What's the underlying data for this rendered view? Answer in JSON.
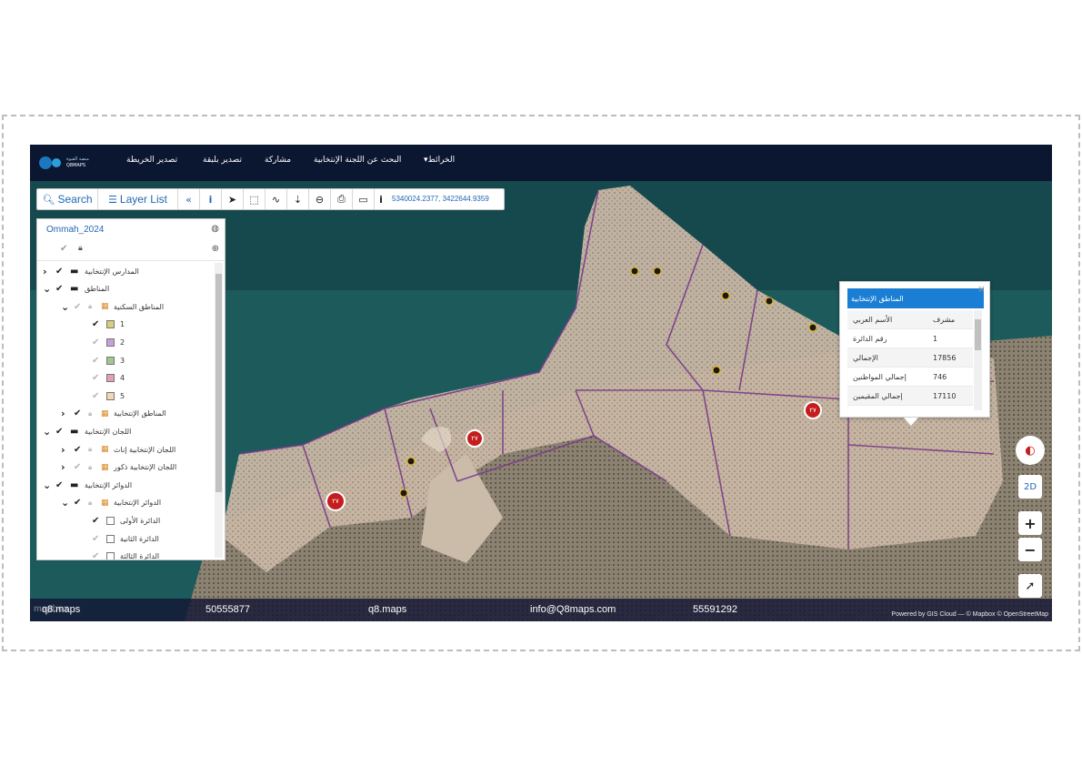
{
  "nav": {
    "logo_text_1": "منصة القبوة",
    "logo_text_2": "Q8MAPS",
    "items": [
      {
        "label": "تصدير الخريطة"
      },
      {
        "label": "تصدير بلبقة"
      },
      {
        "label": "مشاركة"
      },
      {
        "label": "البحث عن اللجنة الإنتخابية"
      },
      {
        "label": "الخرائط"
      }
    ]
  },
  "toolbar": {
    "search_label": "Search",
    "layer_list_label": "Layer List",
    "coordinates": "5340024.2377, 3422644.9359",
    "icons": [
      "collapse-icon",
      "identify-icon",
      "pointer-icon",
      "select-box-icon",
      "measure-icon",
      "location-pin-icon",
      "zoom-out-icon",
      "print-icon",
      "basemap-icon",
      "info-icon"
    ]
  },
  "layer_panel": {
    "title": "Ommah_2024",
    "rows": [
      {
        "label": "المدارس الإنتخابية",
        "level": 0,
        "checked": true
      },
      {
        "label": "المناطق",
        "level": 0,
        "checked": true
      },
      {
        "label": "المناطق السكنية",
        "level": 1,
        "checked": false
      },
      {
        "label": "1",
        "level": 2,
        "checked": true,
        "color": "#d9cc7a"
      },
      {
        "label": "2",
        "level": 2,
        "checked": false,
        "color": "#c7a0d9"
      },
      {
        "label": "3",
        "level": 2,
        "checked": false,
        "color": "#9fc98c"
      },
      {
        "label": "4",
        "level": 2,
        "checked": false,
        "color": "#e0a0b5"
      },
      {
        "label": "5",
        "level": 2,
        "checked": false,
        "color": "#f0d9b0"
      },
      {
        "label": "المناطق الإنتخابية",
        "level": 1,
        "checked": true
      },
      {
        "label": "اللجان الإنتخابية",
        "level": 0,
        "checked": true
      },
      {
        "label": "اللجان الإنتخابية إناث",
        "level": 1,
        "checked": true
      },
      {
        "label": "اللجان الإنتخابية ذكور",
        "level": 1,
        "checked": false
      },
      {
        "label": "الدوائر الإنتخابية",
        "level": 0,
        "checked": true
      },
      {
        "label": "الدوائر الإنتخابية",
        "level": 1,
        "checked": true
      },
      {
        "label": "الدائرة الأولى",
        "level": 2,
        "checked": true,
        "color": "#ffffff"
      },
      {
        "label": "الدائرة الثانية",
        "level": 2,
        "checked": false,
        "color": "#ffffff"
      },
      {
        "label": "الدائرة الثالثة",
        "level": 2,
        "checked": false,
        "color": "#ffffff"
      }
    ]
  },
  "popup": {
    "title": "المناطق الإنتخابية",
    "rows": [
      {
        "key": "الأسم العربي",
        "value": "مشرف"
      },
      {
        "key": "رقم الدائرة",
        "value": "1"
      },
      {
        "key": "الإجمالي",
        "value": "17856"
      },
      {
        "key": "إجمالي المواطنين",
        "value": "746"
      },
      {
        "key": "إجمالي المقيمين",
        "value": "17110"
      }
    ]
  },
  "map_controls": {
    "mode_label": "2D",
    "zoom_in": "+",
    "zoom_out": "−"
  },
  "markers": [
    {
      "label": "٢٧"
    },
    {
      "label": "٢٧"
    },
    {
      "label": "٢٧"
    }
  ],
  "footer": {
    "brand": "q8.maps",
    "phone1": "50555877",
    "handle": "q8.maps",
    "email": "info@Q8maps.com",
    "phone2": "55591292"
  },
  "attribution": "Powered by GIS Cloud — © Mapbox © OpenStreetMap",
  "mapbox_logo": "mapbox"
}
